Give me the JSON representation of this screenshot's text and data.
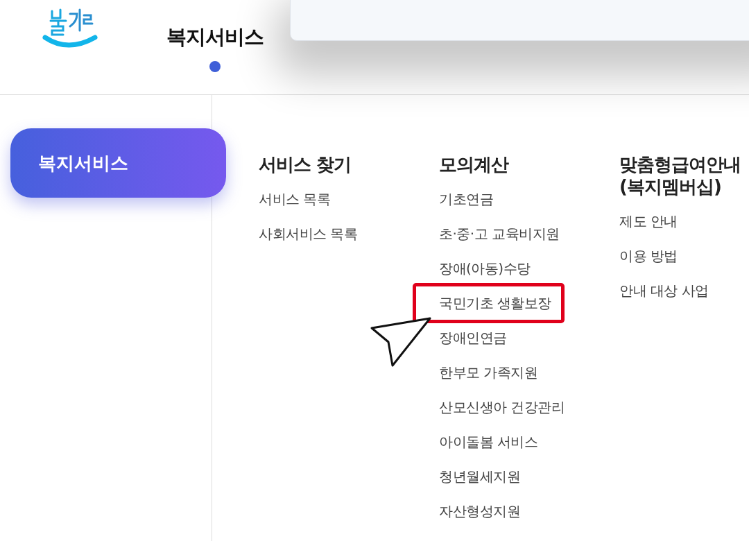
{
  "header": {
    "nav": [
      {
        "label": "복지서비스",
        "selected": true
      }
    ]
  },
  "sidebar": {
    "items": [
      {
        "label": "복지서비스",
        "selected": true
      }
    ]
  },
  "menu_columns": [
    {
      "heading": "서비스 찾기",
      "items": [
        {
          "label": "서비스 목록",
          "highlighted": false
        },
        {
          "label": "사회서비스 목록",
          "highlighted": false
        }
      ]
    },
    {
      "heading": "모의계산",
      "items": [
        {
          "label": "기초연금",
          "highlighted": false
        },
        {
          "label": "초·중·고 교육비지원",
          "highlighted": false
        },
        {
          "label": "장애(아동)수당",
          "highlighted": false
        },
        {
          "label": "국민기초 생활보장",
          "highlighted": true
        },
        {
          "label": "장애인연금",
          "highlighted": false
        },
        {
          "label": "한부모 가족지원",
          "highlighted": false
        },
        {
          "label": "산모신생아 건강관리",
          "highlighted": false
        },
        {
          "label": "아이돌봄 서비스",
          "highlighted": false
        },
        {
          "label": "청년월세지원",
          "highlighted": false
        },
        {
          "label": "자산형성지원",
          "highlighted": false
        }
      ]
    },
    {
      "heading": "맞춤형급여안내 (복지멤버십)",
      "items": [
        {
          "label": "제도 안내",
          "highlighted": false
        },
        {
          "label": "이용 방법",
          "highlighted": false
        },
        {
          "label": "안내 대상 사업",
          "highlighted": false
        }
      ]
    }
  ]
}
